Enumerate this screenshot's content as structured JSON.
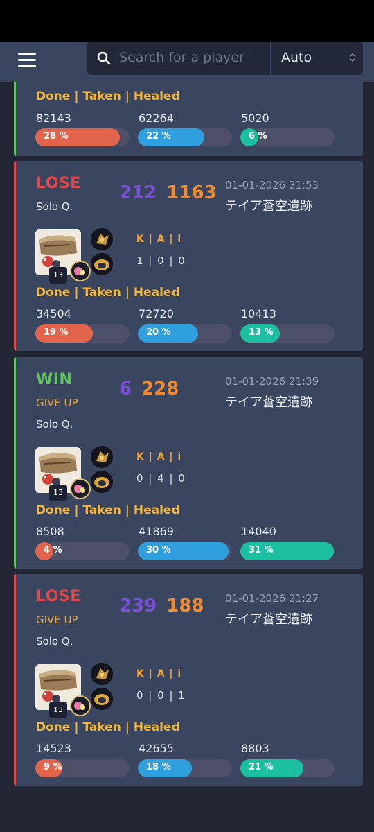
{
  "header": {
    "search_placeholder": "Search for a player",
    "select_value": "Auto"
  },
  "colors": {
    "win": "#5fc35f",
    "lose": "#e0474b",
    "done": "#e2644a",
    "taken": "#2f9fdd",
    "healed": "#1cc0a0"
  },
  "top_card": {
    "labels": "Done | Taken | Healed",
    "stats": [
      {
        "value": "82143",
        "pct": "28 %",
        "fraction": 0.28
      },
      {
        "value": "62264",
        "pct": "22 %",
        "fraction": 0.22
      },
      {
        "value": "5020",
        "pct": "6 %",
        "fraction": 0.06
      }
    ]
  },
  "matches": [
    {
      "result": "LOSE",
      "give_up": "",
      "mode": "Solo Q.",
      "score_a": "212",
      "score_b": "1163",
      "date": "01-01-2026 21:53",
      "map": "テイア蒼空遺跡",
      "level": "13",
      "kda_label": "K | A | i",
      "kda": "1 | 0 | 0",
      "labels": "Done | Taken | Healed",
      "stats": [
        {
          "value": "34504",
          "pct": "19 %",
          "fraction": 0.19
        },
        {
          "value": "72720",
          "pct": "20 %",
          "fraction": 0.2
        },
        {
          "value": "10413",
          "pct": "13 %",
          "fraction": 0.13
        }
      ]
    },
    {
      "result": "WIN",
      "give_up": "GIVE UP",
      "mode": "Solo Q.",
      "score_a": "6",
      "score_b": "228",
      "date": "01-01-2026 21:39",
      "map": "テイア蒼空遺跡",
      "level": "13",
      "kda_label": "K | A | i",
      "kda": "0 | 4 | 0",
      "labels": "Done | Taken | Healed",
      "stats": [
        {
          "value": "8508",
          "pct": "4 %",
          "fraction": 0.04
        },
        {
          "value": "41869",
          "pct": "30 %",
          "fraction": 0.3
        },
        {
          "value": "14040",
          "pct": "31 %",
          "fraction": 0.31
        }
      ]
    },
    {
      "result": "LOSE",
      "give_up": "GIVE UP",
      "mode": "Solo Q.",
      "score_a": "239",
      "score_b": "188",
      "date": "01-01-2026 21:27",
      "map": "テイア蒼空遺跡",
      "level": "13",
      "kda_label": "K | A | i",
      "kda": "0 | 0 | 1",
      "labels": "Done | Taken | Healed",
      "stats": [
        {
          "value": "14523",
          "pct": "9 %",
          "fraction": 0.09
        },
        {
          "value": "42655",
          "pct": "18 %",
          "fraction": 0.18
        },
        {
          "value": "8803",
          "pct": "21 %",
          "fraction": 0.21
        }
      ]
    }
  ]
}
